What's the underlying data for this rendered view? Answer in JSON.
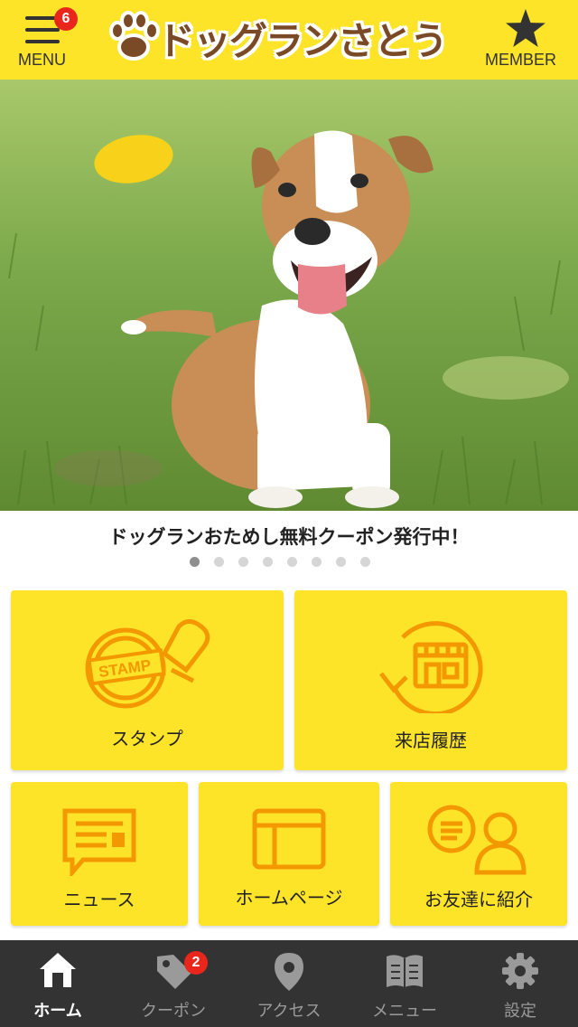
{
  "header": {
    "menu_label": "MENU",
    "menu_badge": "6",
    "logo_text": "ドッグランさとう",
    "member_label": "MEMBER",
    "background_color": "#fde428"
  },
  "hero": {
    "caption": "ドッグランおためし無料クーポン発行中！",
    "slide_count": 8,
    "active_slide": 1
  },
  "tiles": [
    {
      "label": "スタンプ",
      "icon": "stamp-icon"
    },
    {
      "label": "来店履歴",
      "icon": "store-history-icon"
    },
    {
      "label": "ニュース",
      "icon": "news-icon"
    },
    {
      "label": "ホームページ",
      "icon": "homepage-icon"
    },
    {
      "label": "お友達に紹介",
      "icon": "refer-friend-icon"
    }
  ],
  "tabbar": {
    "items": [
      {
        "label": "ホーム",
        "icon": "home-icon",
        "active": true
      },
      {
        "label": "クーポン",
        "icon": "coupon-tag-icon",
        "badge": "2"
      },
      {
        "label": "アクセス",
        "icon": "map-pin-icon"
      },
      {
        "label": "メニュー",
        "icon": "book-icon"
      },
      {
        "label": "設定",
        "icon": "gear-icon"
      }
    ]
  },
  "colors": {
    "accent": "#fde428",
    "icon_orange": "#f39800",
    "badge_red": "#e8261c",
    "tabbar_bg": "#333333"
  }
}
